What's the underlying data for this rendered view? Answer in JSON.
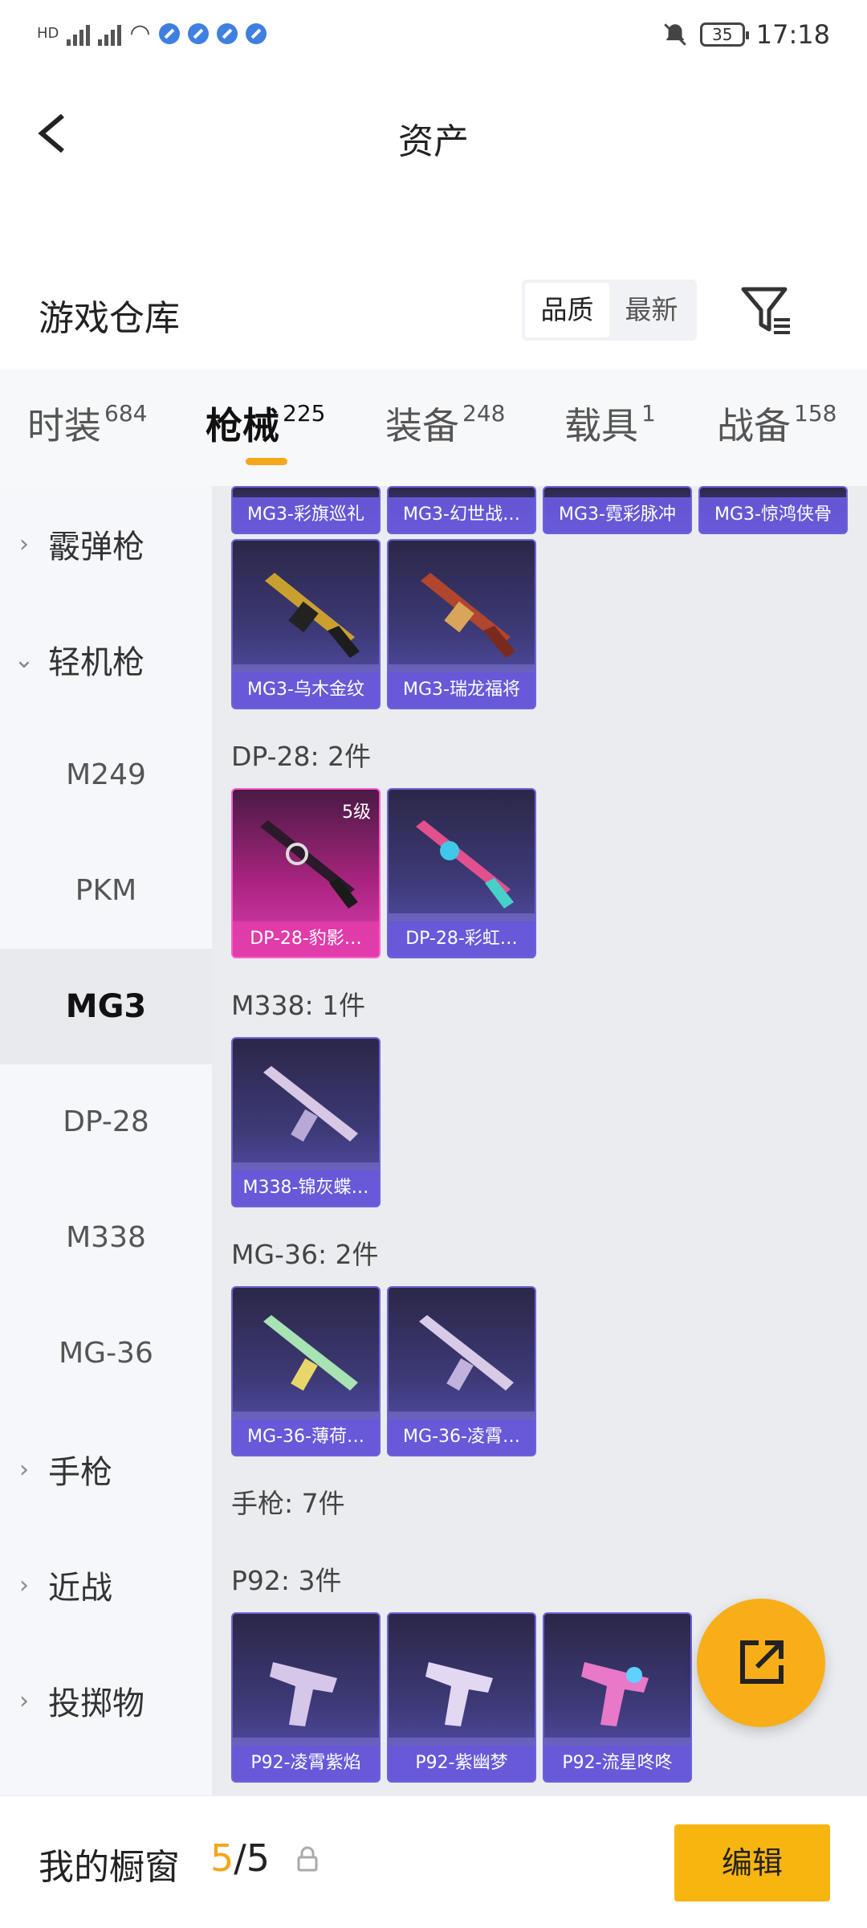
{
  "status": {
    "left_icons": [
      "HD",
      "5G",
      "4G",
      "wifi"
    ],
    "battery": "35",
    "time": "17:18"
  },
  "header": {
    "title": "资产"
  },
  "warehouse": {
    "title": "游戏仓库",
    "sort_options": [
      "品质",
      "最新"
    ],
    "active_sort": "品质"
  },
  "tabs": [
    {
      "label": "时装",
      "count": "684"
    },
    {
      "label": "枪械",
      "count": "225"
    },
    {
      "label": "装备",
      "count": "248"
    },
    {
      "label": "载具",
      "count": "1"
    },
    {
      "label": "战备",
      "count": "158"
    }
  ],
  "sidebar": {
    "shotgun": "霰弹枪",
    "lmg": "轻机枪",
    "subs": [
      "M249",
      "PKM",
      "MG3",
      "DP-28",
      "M338",
      "MG-36"
    ],
    "pistol": "手枪",
    "melee": "近战",
    "throwable": "投掷物"
  },
  "content": {
    "top_row": [
      "MG3-彩旗巡礼",
      "MG3-幻世战…",
      "MG3-霓彩脉冲",
      "MG3-惊鸿侠骨"
    ],
    "mg3_row": [
      "MG3-乌木金纹",
      "MG3-瑞龙福将"
    ],
    "dp28_label": "DP-28: 2件",
    "dp28_row": [
      "DP-28-豹影…",
      "DP-28-彩虹…"
    ],
    "dp28_level": "5级",
    "m338_label": "M338: 1件",
    "m338_row": [
      "M338-锦灰蝶…"
    ],
    "mg36_label": "MG-36: 2件",
    "mg36_row": [
      "MG-36-薄荷…",
      "MG-36-凌霄…"
    ],
    "pistol_label": "手枪: 7件",
    "p92_label": "P92: 3件",
    "p92_row": [
      "P92-凌霄紫焰",
      "P92-紫幽梦",
      "P92-流星咚咚"
    ]
  },
  "bottom": {
    "title": "我的橱窗",
    "current": "5",
    "sep": "/",
    "total": "5",
    "edit_label": "编辑"
  },
  "colors": {
    "accent": "#f3a71a",
    "button": "#f8b40f",
    "card_purple": "#5a54b8",
    "card_pink": "#e03fb4"
  }
}
